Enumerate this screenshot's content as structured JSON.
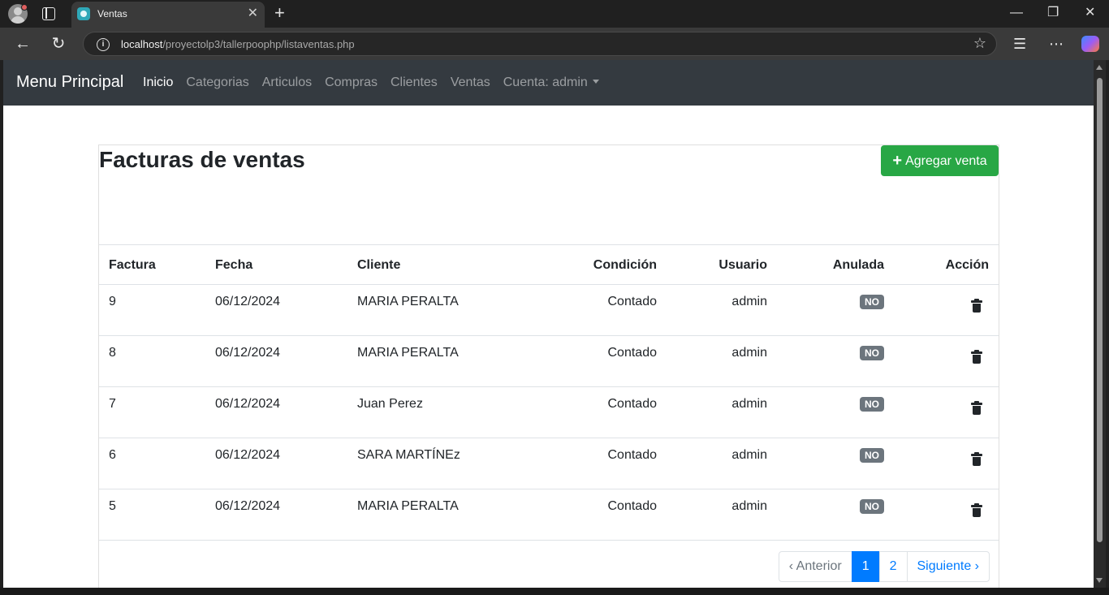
{
  "browser": {
    "tab_title": "Ventas",
    "url_host": "localhost",
    "url_path": "/proyectolp3/tallerpoophp/listaventas.php"
  },
  "navbar": {
    "brand": "Menu Principal",
    "links": [
      "Inicio",
      "Categorias",
      "Articulos",
      "Compras",
      "Clientes",
      "Ventas"
    ],
    "account": "Cuenta: admin"
  },
  "page": {
    "title": "Facturas de ventas",
    "add_button": "Agregar venta"
  },
  "table": {
    "headers": [
      "Factura",
      "Fecha",
      "Cliente",
      "Condición",
      "Usuario",
      "Anulada",
      "Acción"
    ],
    "rows": [
      {
        "factura": "9",
        "fecha": "06/12/2024",
        "cliente": "MARIA PERALTA",
        "condicion": "Contado",
        "usuario": "admin",
        "anulada": "NO"
      },
      {
        "factura": "8",
        "fecha": "06/12/2024",
        "cliente": "MARIA PERALTA",
        "condicion": "Contado",
        "usuario": "admin",
        "anulada": "NO"
      },
      {
        "factura": "7",
        "fecha": "06/12/2024",
        "cliente": "Juan Perez",
        "condicion": "Contado",
        "usuario": "admin",
        "anulada": "NO"
      },
      {
        "factura": "6",
        "fecha": "06/12/2024",
        "cliente": "SARA MARTÍNEz",
        "condicion": "Contado",
        "usuario": "admin",
        "anulada": "NO"
      },
      {
        "factura": "5",
        "fecha": "06/12/2024",
        "cliente": "MARIA PERALTA",
        "condicion": "Contado",
        "usuario": "admin",
        "anulada": "NO"
      }
    ]
  },
  "pagination": {
    "prev": "‹ Anterior",
    "pages": [
      "1",
      "2"
    ],
    "next": "Siguiente ›"
  },
  "colors": {
    "navbar_bg": "#343a40",
    "success": "#28a745",
    "primary": "#007bff",
    "badge": "#6c757d"
  }
}
